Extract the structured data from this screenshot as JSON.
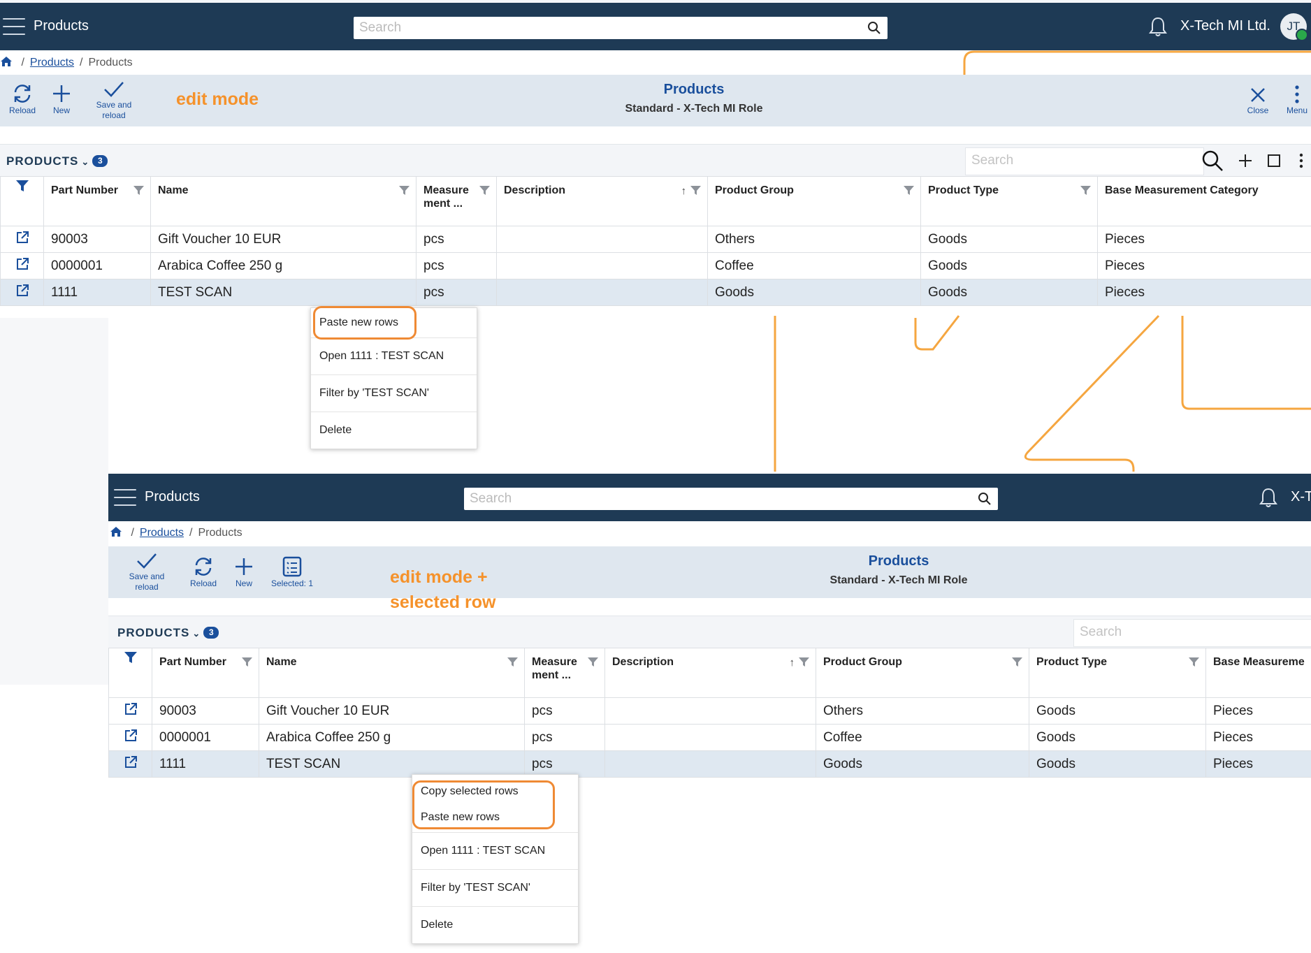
{
  "colors": {
    "header": "#1e3a55",
    "accent": "#1a4f9c",
    "annotation": "#f5922b",
    "selected_row": "#dfe8f1"
  },
  "top": {
    "appbar": {
      "title": "Products",
      "search_placeholder": "Search",
      "company": "X-Tech MI Ltd.",
      "avatar": "JT"
    },
    "breadcrumb": {
      "link": "Products",
      "current": "Products"
    },
    "toolbar": {
      "reload": "Reload",
      "new": "New",
      "save_reload": "Save and reload",
      "close": "Close",
      "menu": "Menu",
      "title": "Products",
      "subtitle": "Standard - X-Tech MI Role"
    },
    "annotation": "edit mode",
    "section": {
      "label": "PRODUCTS",
      "count": "3",
      "search_placeholder": "Search"
    },
    "context_menu": [
      "Paste new rows",
      "Open 1111 : TEST SCAN",
      "Filter by 'TEST SCAN'",
      "Delete"
    ]
  },
  "bottom": {
    "appbar": {
      "title": "Products",
      "search_placeholder": "Search",
      "company": "X-T"
    },
    "breadcrumb": {
      "link": "Products",
      "current": "Products"
    },
    "toolbar": {
      "save_reload": "Save and reload",
      "reload": "Reload",
      "new": "New",
      "selected": "Selected: 1",
      "title": "Products",
      "subtitle": "Standard - X-Tech MI Role"
    },
    "annotation_line1": "edit mode +",
    "annotation_line2": "selected row",
    "section": {
      "label": "PRODUCTS",
      "count": "3",
      "search_placeholder": "Search"
    },
    "context_menu": [
      "Copy selected rows",
      "Paste new rows",
      "Open 1111 : TEST SCAN",
      "Filter by 'TEST SCAN'",
      "Delete"
    ]
  },
  "table": {
    "columns": [
      "Part Number",
      "Name",
      "Measure ment ...",
      "Description",
      "Product Group",
      "Product Type",
      "Base Measurement Category"
    ],
    "columns_bottom_last": "Base Measureme",
    "rows": [
      [
        "90003",
        "Gift Voucher 10 EUR",
        "pcs",
        "",
        "Others",
        "Goods",
        "Pieces"
      ],
      [
        "0000001",
        "Arabica Coffee 250 g",
        "pcs",
        "",
        "Coffee",
        "Goods",
        "Pieces"
      ],
      [
        "1111",
        "TEST SCAN",
        "pcs",
        "",
        "Goods",
        "Goods",
        "Pieces"
      ]
    ]
  }
}
